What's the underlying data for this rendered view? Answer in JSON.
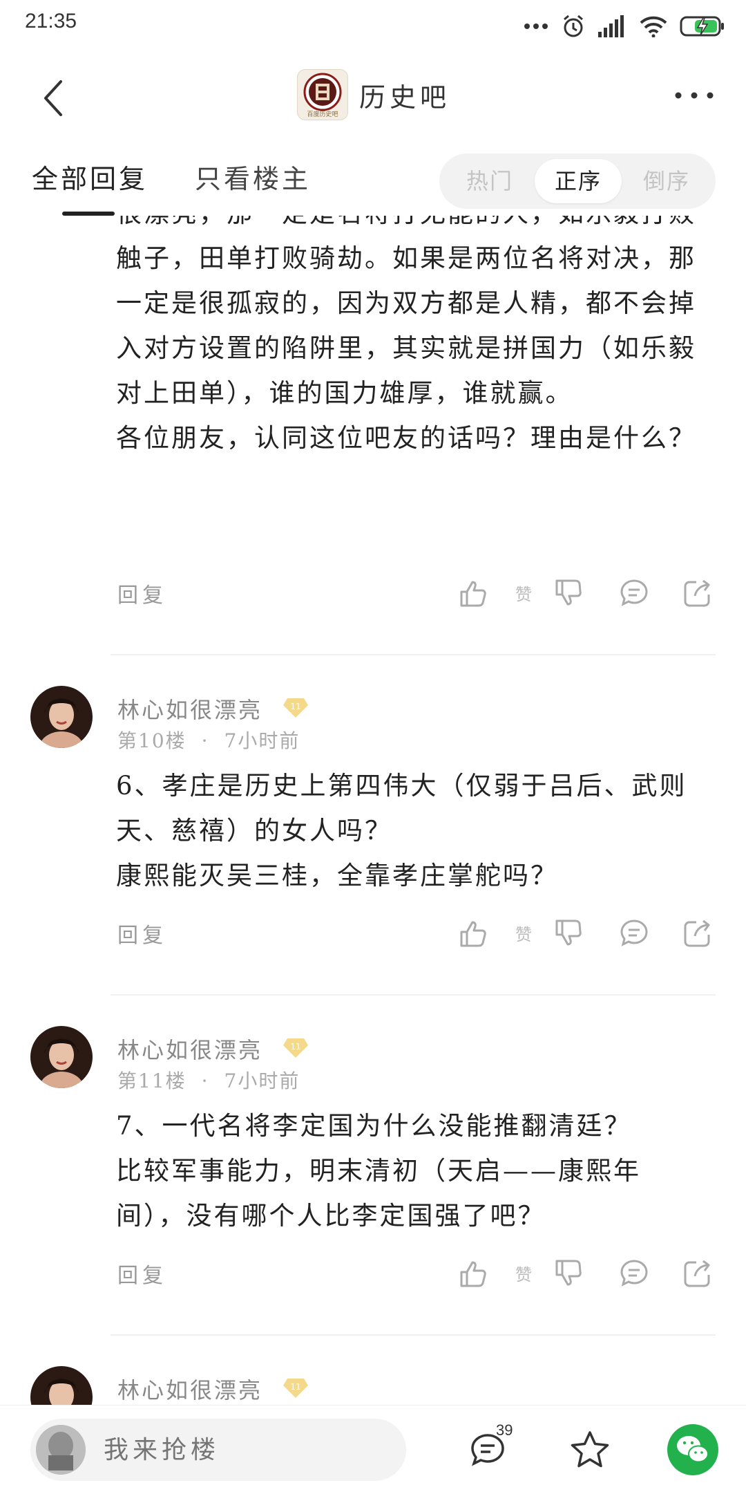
{
  "status_bar": {
    "time": "21:35"
  },
  "header": {
    "forum_title": "历史吧",
    "logo_text": "百度历史吧"
  },
  "tabs": {
    "all_replies": "全部回复",
    "op_only": "只看楼主",
    "sort": {
      "hot": "热门",
      "asc": "正序",
      "desc": "倒序",
      "selected": "正序"
    }
  },
  "posts": [
    {
      "body": "很漂亮，那一定是名将打无能的人，如乐毅打败触子，田单打败骑劫。如果是两位名将对决，那一定是很孤寂的，因为双方都是人精，都不会掉入对方设置的陷阱里，其实就是拼国力（如乐毅对上田单），谁的国力雄厚，谁就赢。\n各位朋友，认同这位吧友的话吗？理由是什么？",
      "reply_label": "回复",
      "like_label": "赞"
    },
    {
      "author": "林心如很漂亮",
      "level": "11",
      "floor": "第10楼",
      "dot": "·",
      "time": "7小时前",
      "body": "6、孝庄是历史上第四伟大（仅弱于吕后、武则天、慈禧）的女人吗？\n康熙能灭吴三桂，全靠孝庄掌舵吗？",
      "reply_label": "回复",
      "like_label": "赞"
    },
    {
      "author": "林心如很漂亮",
      "level": "11",
      "floor": "第11楼",
      "dot": "·",
      "time": "7小时前",
      "body": "7、一代名将李定国为什么没能推翻清廷？\n比较军事能力，明末清初（天启——康熙年间），没有哪个人比李定国强了吧？",
      "reply_label": "回复",
      "like_label": "赞"
    },
    {
      "author": "林心如很漂亮",
      "level": "11"
    }
  ],
  "bottom_bar": {
    "input_placeholder": "我来抢楼",
    "comment_count": "39"
  },
  "colors": {
    "wechat_green": "#22b14c",
    "level_badge": "#f5d98a",
    "battery_green": "#3ac25a"
  }
}
